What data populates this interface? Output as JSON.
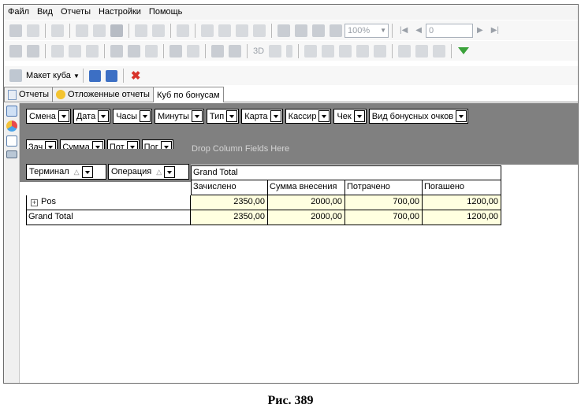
{
  "menu": [
    "Файл",
    "Вид",
    "Отчеты",
    "Настройки",
    "Помощь"
  ],
  "toolbar": {
    "zoom": "100%",
    "page": "0",
    "label_3d": "3D"
  },
  "cube_toolbar": {
    "layout_label": "Макет куба"
  },
  "tabs": [
    "Отчеты",
    "Отложенные отчеты",
    "Куб по бонусам"
  ],
  "pivot": {
    "filter_fields": [
      "Смена",
      "Дата",
      "Часы",
      "Минуты",
      "Тип",
      "Карта",
      "Кассир",
      "Чек",
      "Вид бонусных очков"
    ],
    "data_fields": [
      "Зач",
      "Сумма",
      "Пот",
      "Пог"
    ],
    "drop_column_text": "Drop Column Fields Here",
    "row_fields": [
      "Терминал",
      "Операция"
    ],
    "column_group_header": "Grand Total",
    "columns": [
      "Зачислено",
      "Сумма внесения",
      "Потрачено",
      "Погашено"
    ],
    "rows": [
      {
        "label": "Pos",
        "expandable": true,
        "values": [
          "2350,00",
          "2000,00",
          "700,00",
          "1200,00"
        ]
      },
      {
        "label": "Grand Total",
        "expandable": false,
        "values": [
          "2350,00",
          "2000,00",
          "700,00",
          "1200,00"
        ]
      }
    ]
  },
  "caption": "Рис. 389"
}
